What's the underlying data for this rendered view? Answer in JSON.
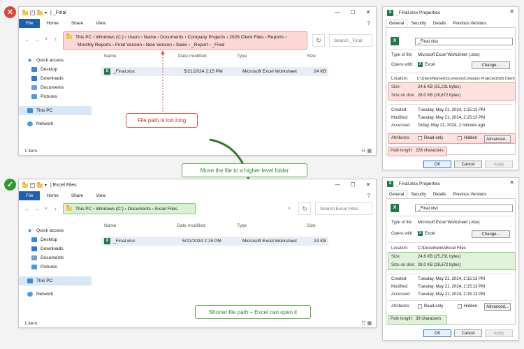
{
  "badges": {
    "bad": "✕",
    "good": "✓"
  },
  "top_explorer": {
    "title": "_Final",
    "tabs": [
      "File",
      "Home",
      "Share",
      "View"
    ],
    "address_line1": "This PC  ›  Windows (C:)  ›  Users  ›  Name  ›  Documents  ›  Company Projects  ›  2026 Client Files  ›  Reports  ›",
    "address_line2": "Monthly Reports  ›  Final Version  ›  New Version  ›  Sales  ›  _Report  ›  _Final",
    "search_placeholder": "Search _Final",
    "sidebar": [
      "Quick access",
      "Desktop",
      "Downloads",
      "Documents",
      "Pictures",
      "This PC",
      "Network"
    ],
    "columns": [
      "Name",
      "Date modified",
      "Type",
      "Size"
    ],
    "file": {
      "name": "_Final.xlsx",
      "date": "5/21/2024 2:15 PM",
      "type": "Microsoft Excel Worksheet",
      "size": "24 KB"
    },
    "status": "1 item"
  },
  "bottom_explorer": {
    "title": "Excel Files",
    "tabs": [
      "File",
      "Home",
      "Share",
      "View"
    ],
    "address": "This PC  ›  Windows (C:)  ›  Documents  ›  Excel Files",
    "search_placeholder": "Search Excel Files",
    "sidebar": [
      "Quick access",
      "Desktop",
      "Downloads",
      "Documents",
      "Pictures",
      "This PC",
      "Network"
    ],
    "columns": [
      "Name",
      "Date modified",
      "Type",
      "Size"
    ],
    "file": {
      "name": "_Final.xlsx",
      "date": "5/21/2024 2:15 PM",
      "type": "Microsoft Excel Worksheet",
      "size": "24 KB"
    },
    "status": "1 item"
  },
  "callouts": {
    "too_long": "File path is too long",
    "move": "Move the file to a higher-level folder",
    "shorter": "Shorter file path – Excel can open it"
  },
  "props_top": {
    "title": "_Final.xlsx Properties",
    "tabs": [
      "General",
      "Security",
      "Details",
      "Previous Versions"
    ],
    "filename": "_Final.xlsx",
    "type_label": "Type of file:",
    "type_value": "Microsoft Excel Worksheet (.xlsx)",
    "opens_label": "Opens with:",
    "opens_value": "Excel",
    "change_btn": "Change...",
    "location_label": "Location:",
    "location_value": "C:\\Users\\Name\\Documents\\Company Projects\\2026 Client Fi",
    "size_label": "Size:",
    "size_value": "24.6 KB (25,231 bytes)",
    "disk_label": "Size on disk:",
    "disk_value": "28.0 KB (28,672 bytes)",
    "created_label": "Created:",
    "created_value": "Tuesday, May 21, 2024, 2:15:13 PM",
    "modified_label": "Modified:",
    "modified_value": "Tuesday, May 21, 2024, 2:15:13 PM",
    "accessed_label": "Accessed:",
    "accessed_value": "Today, May 21, 2024, 2 minutes ago",
    "attr_label": "Attributes:",
    "readonly": "Read-only",
    "hidden": "Hidden",
    "advanced_btn": "Advanced...",
    "path_label": "Path length:",
    "path_value": "228 characters",
    "ok": "OK",
    "cancel": "Cancel",
    "apply": "Apply"
  },
  "props_bottom": {
    "title": "_Final.xlsx Properties",
    "tabs": [
      "General",
      "Security",
      "Details",
      "Previous Versions"
    ],
    "filename": "_Final.xlsx",
    "type_label": "Type of file:",
    "type_value": "Microsoft Excel Worksheet (.xlsx)",
    "opens_label": "Opens with:",
    "opens_value": "Excel",
    "change_btn": "Change...",
    "location_label": "Location:",
    "location_value": "C:\\Documents\\Excel Files",
    "size_label": "Size:",
    "size_value": "24.6 KB (25,231 bytes)",
    "disk_label": "Size on disk:",
    "disk_value": "28.0 KB (28,672 bytes)",
    "created_label": "Created:",
    "created_value": "Tuesday, May 21, 2024, 2:15:13 PM",
    "modified_label": "Modified:",
    "modified_value": "Tuesday, May 21, 2024, 2:15:13 PM",
    "accessed_label": "Accessed:",
    "accessed_value": "Tuesday, May 21, 2024, 2:15:13 PM",
    "attr_label": "Attributes:",
    "readonly": "Read-only",
    "hidden": "Hidden",
    "advanced_btn": "Advanced...",
    "path_label": "Path length:",
    "path_value": "39 characters",
    "ok": "OK",
    "cancel": "Cancel",
    "apply": "Apply"
  }
}
